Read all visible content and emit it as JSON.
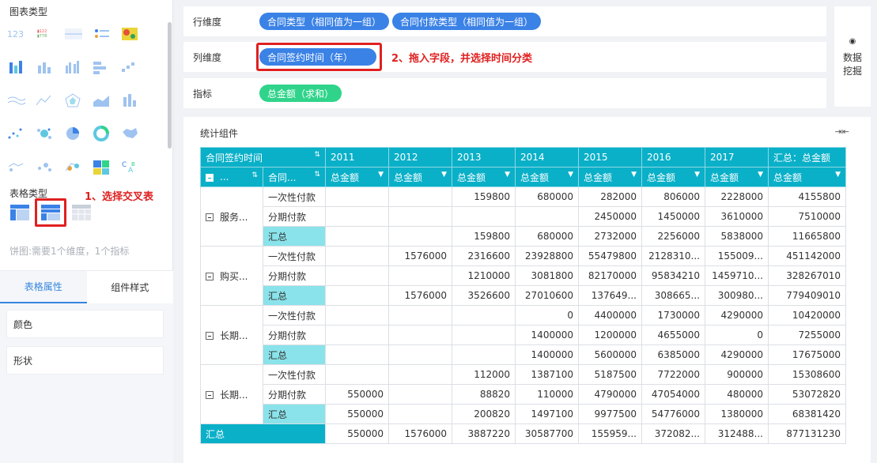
{
  "left": {
    "chart_type_title": "图表类型",
    "table_type_title": "表格类型",
    "hint": "饼图:需要1个维度，1个指标",
    "tabs": [
      "表格属性",
      "组件样式"
    ],
    "props": [
      "颜色",
      "形状"
    ],
    "chart_icons": [
      "kpi-number-icon",
      "kpi-table-icon",
      "kpi-grid-icon",
      "kpi-color-icon",
      "heatmap-icon",
      "stacked-bar-icon",
      "bar-chart-icon",
      "grouped-bar-icon",
      "horizontal-bar-icon",
      "step-chart-icon",
      "line-wave-icon",
      "line-chart-icon",
      "radar-icon",
      "area-chart-icon",
      "column-chart-icon",
      "scatter-icon",
      "bubble-icon",
      "pie-chart-icon",
      "donut-icon",
      "map-icon",
      "flow-map-icon",
      "point-map-icon",
      "funnel-icon",
      "treemap-icon",
      "word-cloud-icon"
    ],
    "table_icons": [
      "group-table-icon",
      "cross-table-icon",
      "detail-table-icon"
    ]
  },
  "annotations": {
    "step1": "1、选择交叉表",
    "step2": "2、拖入字段，并选择时间分类"
  },
  "dims": {
    "row_label": "行维度",
    "row_pills": [
      "合同类型（相同值为一组）",
      "合同付款类型（相同值为一组）"
    ],
    "col_label": "列维度",
    "col_pills": [
      "合同签约时间（年）"
    ],
    "metric_label": "指标",
    "metric_pills": [
      "总金额（求和）"
    ]
  },
  "mining": {
    "line1": "数据",
    "line2": "挖掘"
  },
  "stats": {
    "title": "统计组件",
    "header1": {
      "corner": "合同签约时间",
      "years": [
        "2011",
        "2012",
        "2013",
        "2014",
        "2015",
        "2016",
        "2017"
      ],
      "total": "汇总：总金额"
    },
    "header2": {
      "c1": "...",
      "c2": "合同...",
      "metric": "总金额"
    },
    "groups": [
      {
        "name": "服务...",
        "rows": [
          {
            "label": "一次性付款",
            "vals": [
              "",
              "",
              "159800",
              "680000",
              "282000",
              "806000",
              "2228000",
              "4155800"
            ]
          },
          {
            "label": "分期付款",
            "vals": [
              "",
              "",
              "",
              "",
              "2450000",
              "1450000",
              "3610000",
              "7510000"
            ]
          },
          {
            "label": "汇总",
            "vals": [
              "",
              "",
              "159800",
              "680000",
              "2732000",
              "2256000",
              "5838000",
              "11665800"
            ]
          }
        ]
      },
      {
        "name": "购买...",
        "rows": [
          {
            "label": "一次性付款",
            "vals": [
              "",
              "1576000",
              "2316600",
              "23928800",
              "55479800",
              "2128310...",
              "155009...",
              "451142000"
            ]
          },
          {
            "label": "分期付款",
            "vals": [
              "",
              "",
              "1210000",
              "3081800",
              "82170000",
              "95834210",
              "1459710...",
              "328267010"
            ]
          },
          {
            "label": "汇总",
            "vals": [
              "",
              "1576000",
              "3526600",
              "27010600",
              "137649...",
              "308665...",
              "300980...",
              "779409010"
            ]
          }
        ]
      },
      {
        "name": "长期...",
        "rows": [
          {
            "label": "一次性付款",
            "vals": [
              "",
              "",
              "",
              "0",
              "4400000",
              "1730000",
              "4290000",
              "10420000"
            ]
          },
          {
            "label": "分期付款",
            "vals": [
              "",
              "",
              "",
              "1400000",
              "1200000",
              "4655000",
              "0",
              "7255000"
            ]
          },
          {
            "label": "汇总",
            "vals": [
              "",
              "",
              "",
              "1400000",
              "5600000",
              "6385000",
              "4290000",
              "17675000"
            ]
          }
        ]
      },
      {
        "name": "长期...",
        "rows": [
          {
            "label": "一次性付款",
            "vals": [
              "",
              "",
              "112000",
              "1387100",
              "5187500",
              "7722000",
              "900000",
              "15308600"
            ]
          },
          {
            "label": "分期付款",
            "vals": [
              "550000",
              "",
              "88820",
              "110000",
              "4790000",
              "47054000",
              "480000",
              "53072820"
            ]
          },
          {
            "label": "汇总",
            "vals": [
              "550000",
              "",
              "200820",
              "1497100",
              "9977500",
              "54776000",
              "1380000",
              "68381420"
            ]
          }
        ]
      }
    ],
    "grand": {
      "label": "汇总",
      "vals": [
        "550000",
        "1576000",
        "3887220",
        "30587700",
        "155959...",
        "372082...",
        "312488...",
        "877131230"
      ]
    }
  }
}
